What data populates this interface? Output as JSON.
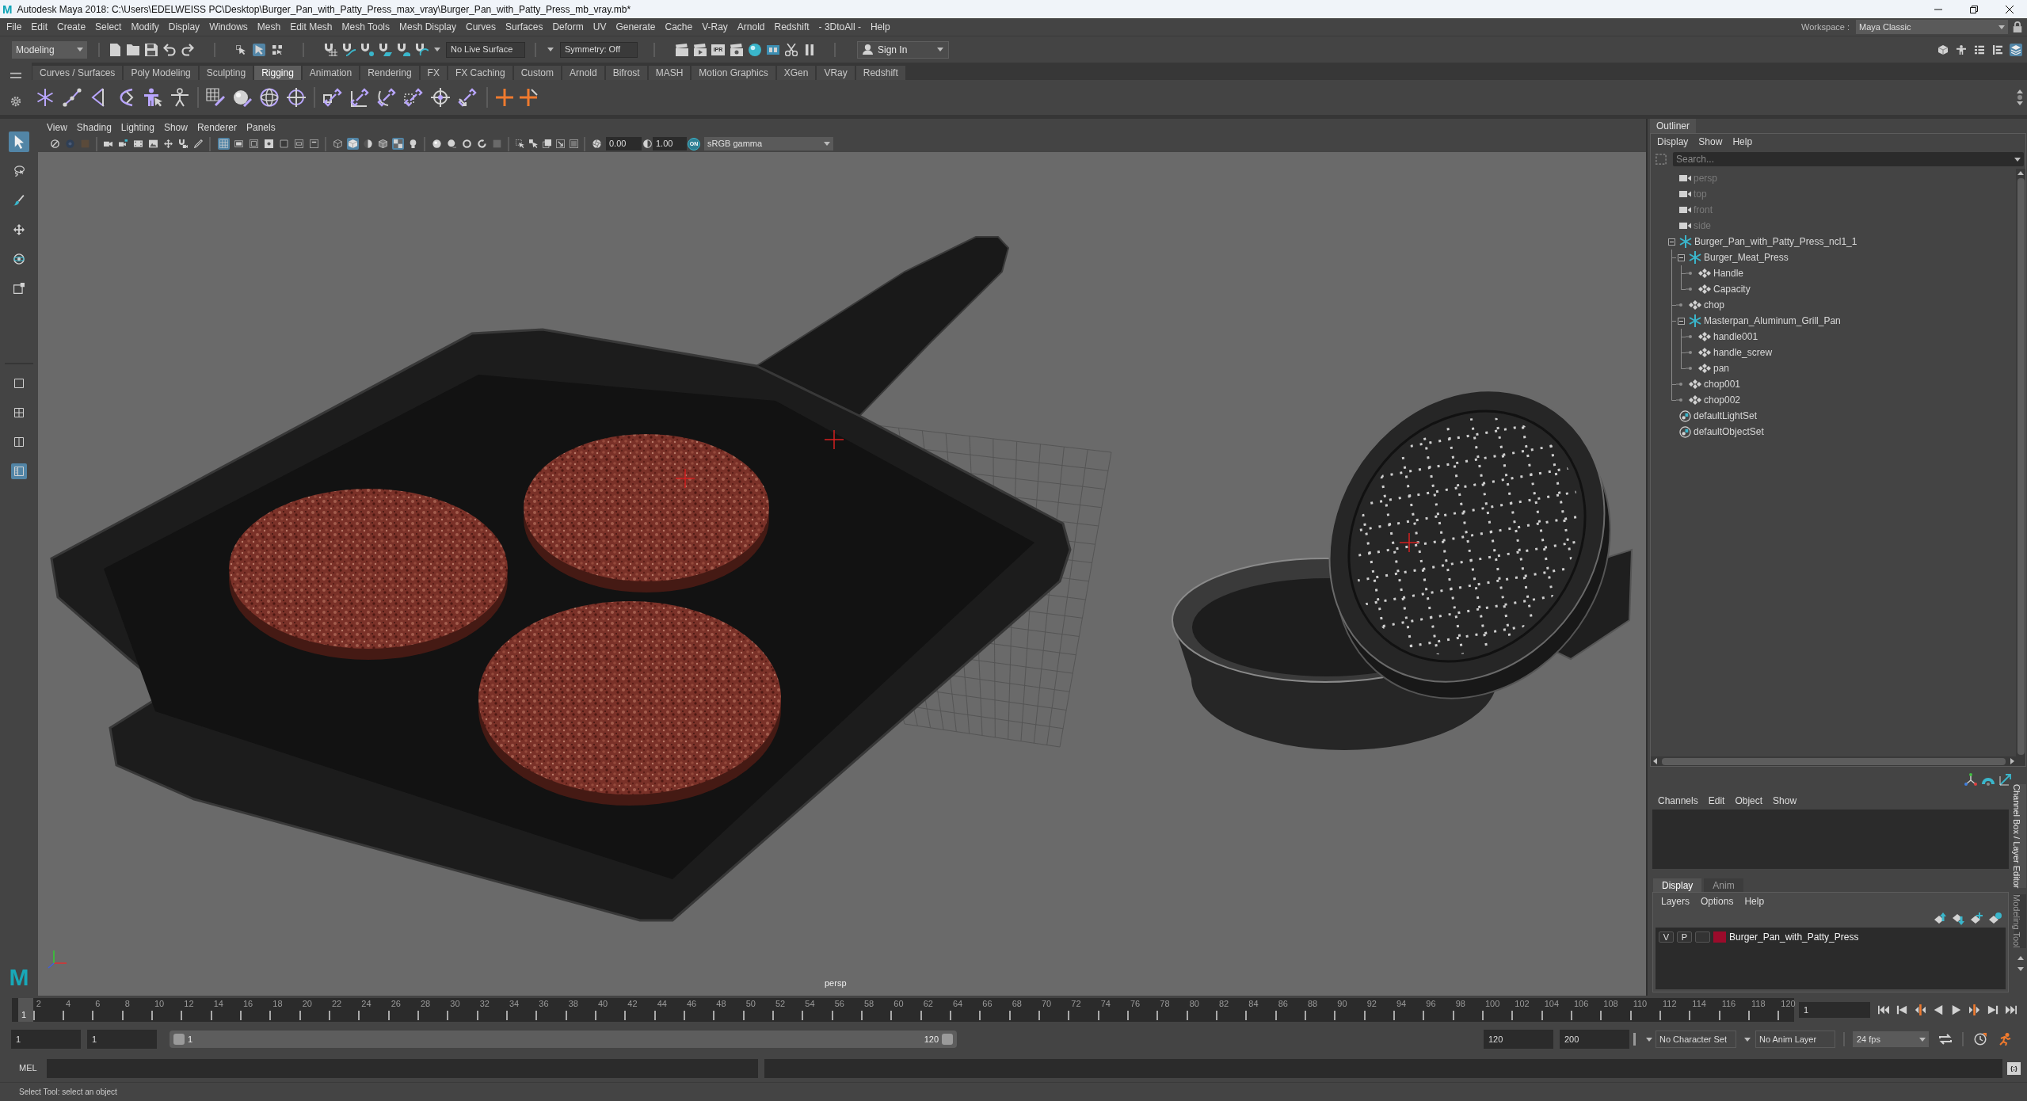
{
  "window": {
    "logo": "M",
    "title": "Autodesk Maya 2018: C:\\Users\\EDELWEISS PC\\Desktop\\Burger_Pan_with_Patty_Press_max_vray\\Burger_Pan_with_Patty_Press_mb_vray.mb*"
  },
  "menu_bar": {
    "items": [
      "File",
      "Edit",
      "Create",
      "Select",
      "Modify",
      "Display",
      "Windows",
      "Mesh",
      "Edit Mesh",
      "Mesh Tools",
      "Mesh Display",
      "Curves",
      "Surfaces",
      "Deform",
      "UV",
      "Generate",
      "Cache",
      "V-Ray",
      "Arnold",
      "Redshift",
      "- 3DtoAll -",
      "Help"
    ],
    "workspace_label": "Workspace :",
    "workspace": "Maya Classic"
  },
  "status_line": {
    "menu_set": "Modeling",
    "selection_modes": [
      {
        "selected": false
      },
      {
        "selected": true
      },
      {
        "selected": false
      }
    ],
    "live_surface": "No Live Surface",
    "symmetry": "Symmetry: Off",
    "ipr_label": "IPR",
    "sign_in": "Sign In",
    "panel_toggles": [
      {
        "on": false
      },
      {
        "on": false
      },
      {
        "on": false
      },
      {
        "on": false
      },
      {
        "on": true
      }
    ]
  },
  "shelf": {
    "tabs": [
      {
        "label": "Curves / Surfaces",
        "selected": false
      },
      {
        "label": "Poly Modeling",
        "selected": false
      },
      {
        "label": "Sculpting",
        "selected": false
      },
      {
        "label": "Rigging",
        "selected": true
      },
      {
        "label": "Animation",
        "selected": false
      },
      {
        "label": "Rendering",
        "selected": false
      },
      {
        "label": "FX",
        "selected": false
      },
      {
        "label": "FX Caching",
        "selected": false
      },
      {
        "label": "Custom",
        "selected": false
      },
      {
        "label": "Arnold",
        "selected": false
      },
      {
        "label": "Bifrost",
        "selected": false
      },
      {
        "label": "MASH",
        "selected": false
      },
      {
        "label": "Motion Graphics",
        "selected": false
      },
      {
        "label": "XGen",
        "selected": false
      },
      {
        "label": "VRay",
        "selected": false
      },
      {
        "label": "Redshift",
        "selected": false
      }
    ]
  },
  "toolbox": {
    "tools": [
      {
        "selected": true
      },
      {
        "selected": false
      },
      {
        "selected": false
      },
      {
        "selected": false
      },
      {
        "selected": false
      },
      {
        "selected": false
      }
    ],
    "layouts": [
      {
        "selected": false
      },
      {
        "selected": false
      },
      {
        "selected": false
      },
      {
        "selected": true
      }
    ],
    "logo": "M"
  },
  "viewport": {
    "menus": [
      "View",
      "Shading",
      "Lighting",
      "Show",
      "Renderer",
      "Panels"
    ],
    "toolbar": [
      {
        "on": false
      },
      {
        "on": false
      },
      {
        "on": false
      },
      {
        "on": false
      },
      {
        "on": false
      },
      {
        "on": false
      },
      {
        "on": false
      },
      {
        "on": false
      },
      {
        "on": false
      },
      {
        "on": false
      },
      {
        "on": true
      },
      {
        "on": false
      },
      {
        "on": false
      },
      {
        "on": false
      },
      {
        "on": false
      },
      {
        "on": false
      },
      {
        "on": false
      },
      {
        "on": false
      },
      {
        "on": true
      },
      {
        "on": false
      },
      {
        "on": false
      },
      {
        "on": true
      },
      {
        "on": false
      },
      {
        "on": false
      },
      {
        "on": false
      },
      {
        "on": false
      },
      {
        "on": false
      },
      {
        "on": false
      },
      {
        "on": false
      },
      {
        "on": false
      },
      {
        "on": false
      },
      {
        "on": false
      },
      {
        "on": false
      },
      {
        "on": false
      },
      {
        "on": false
      }
    ],
    "exposure": "0.00",
    "gamma": "1.00",
    "color_management": {
      "label": "ON",
      "on": true
    },
    "color_space": "sRGB gamma",
    "camera": "persp"
  },
  "outliner": {
    "title": "Outliner",
    "menus": [
      "Display",
      "Show",
      "Help"
    ],
    "search": {
      "placeholder": "Search..."
    },
    "items": [
      {
        "label": "persp",
        "kind": "camera",
        "dimmed": true
      },
      {
        "label": "top",
        "kind": "camera",
        "dimmed": true
      },
      {
        "label": "front",
        "kind": "camera",
        "dimmed": true
      },
      {
        "label": "side",
        "kind": "camera",
        "dimmed": true
      },
      {
        "label": "Burger_Pan_with_Patty_Press_ncl1_1",
        "kind": "group",
        "dimmed": false,
        "expanded": true,
        "children": [
          {
            "label": "Burger_Meat_Press",
            "kind": "group",
            "dimmed": false,
            "expanded": true,
            "children": [
              {
                "label": "Handle",
                "kind": "mesh",
                "dimmed": false
              },
              {
                "label": "Capacity",
                "kind": "mesh",
                "dimmed": false
              }
            ]
          },
          {
            "label": "chop",
            "kind": "mesh",
            "dimmed": false
          },
          {
            "label": "Masterpan_Aluminum_Grill_Pan",
            "kind": "group",
            "dimmed": false,
            "expanded": true,
            "children": [
              {
                "label": "handle001",
                "kind": "mesh",
                "dimmed": false
              },
              {
                "label": "handle_screw",
                "kind": "mesh",
                "dimmed": false
              },
              {
                "label": "pan",
                "kind": "mesh",
                "dimmed": false
              }
            ]
          },
          {
            "label": "chop001",
            "kind": "mesh",
            "dimmed": false
          },
          {
            "label": "chop002",
            "kind": "mesh",
            "dimmed": false
          }
        ]
      },
      {
        "label": "defaultLightSet",
        "kind": "set",
        "dimmed": false
      },
      {
        "label": "defaultObjectSet",
        "kind": "set",
        "dimmed": false
      }
    ]
  },
  "channel_box": {
    "menus": [
      "Channels",
      "Edit",
      "Object",
      "Show"
    ]
  },
  "layer_editor": {
    "tabs": [
      {
        "label": "Display",
        "selected": true
      },
      {
        "label": "Anim",
        "selected": false
      }
    ],
    "menus": [
      "Layers",
      "Options",
      "Help"
    ],
    "layers": [
      {
        "visible": "V",
        "playback": "P",
        "color": "#9b0b2b",
        "name": "Burger_Pan_with_Patty_Press"
      }
    ]
  },
  "side_tabs": [
    {
      "label": "Channel Box / Layer Editor",
      "selected": true
    },
    {
      "label": "Modeling Tool",
      "selected": false
    }
  ],
  "timeline": {
    "labels": [
      "2",
      "4",
      "6",
      "8",
      "10",
      "12",
      "14",
      "16",
      "18",
      "20",
      "22",
      "24",
      "26",
      "28",
      "30",
      "32",
      "34",
      "36",
      "38",
      "40",
      "42",
      "44",
      "46",
      "48",
      "50",
      "52",
      "54",
      "56",
      "58",
      "60",
      "62",
      "64",
      "66",
      "68",
      "70",
      "72",
      "74",
      "76",
      "78",
      "80",
      "82",
      "84",
      "86",
      "88",
      "90",
      "92",
      "94",
      "96",
      "98",
      "100",
      "102",
      "104",
      "106",
      "108",
      "110",
      "112",
      "114",
      "116",
      "118",
      "120"
    ],
    "current_frame_marker": "1",
    "current_frame": "1"
  },
  "range": {
    "animation_start": "1",
    "playback_start": "1",
    "bar_start": "1",
    "bar_end": "120",
    "playback_end": "120",
    "animation_end": "200",
    "character_set": "No Character Set",
    "anim_layer": "No Anim Layer",
    "fps": "24 fps"
  },
  "command_line": {
    "language": "MEL",
    "script_editor": "{;}"
  },
  "help_line": "Select Tool: select an object"
}
